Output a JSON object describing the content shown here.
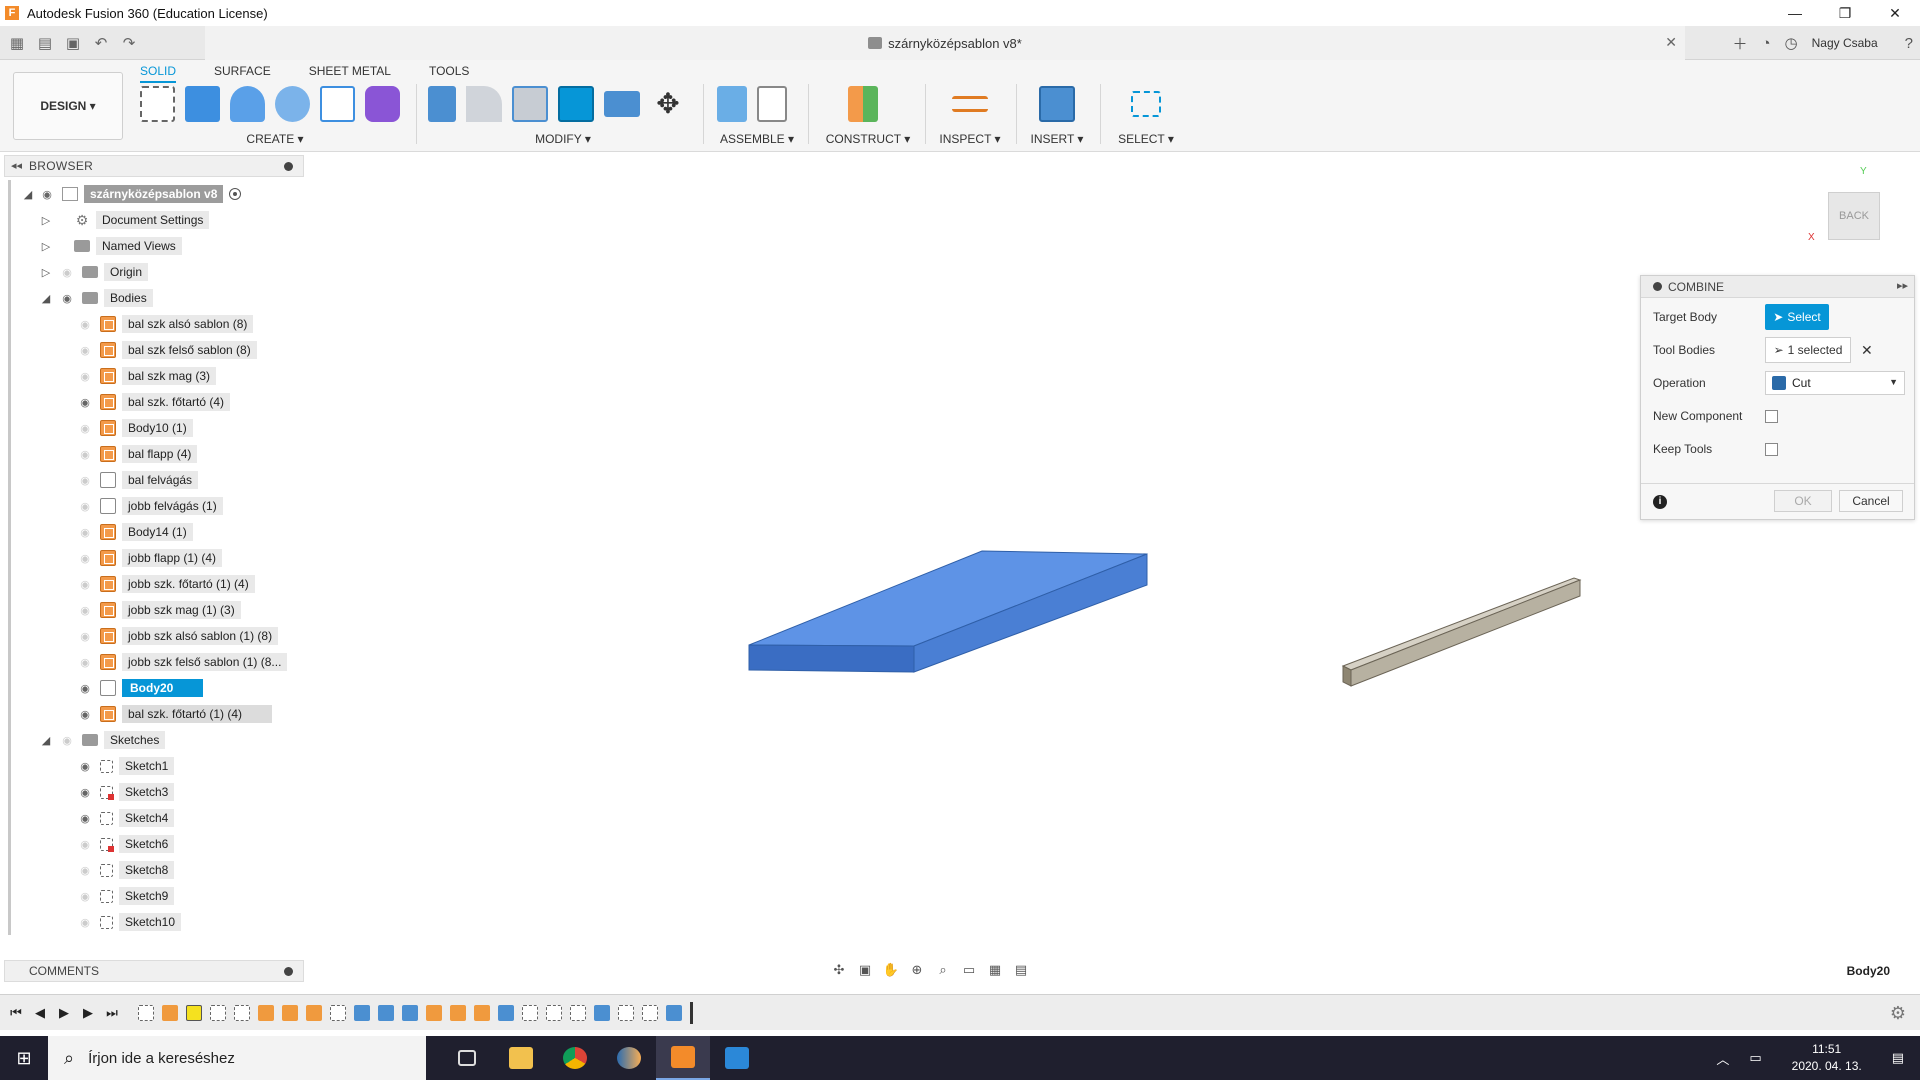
{
  "window": {
    "title": "Autodesk Fusion 360 (Education License)",
    "logo_letter": "F",
    "min": "—",
    "restore": "❐",
    "close": "✕"
  },
  "tabbar": {
    "doc_title": "szárnyközépsablon v8*",
    "user": "Nagy Csaba"
  },
  "ribbon": {
    "workspace": "DESIGN ▾",
    "tabs": [
      "SOLID",
      "SURFACE",
      "SHEET METAL",
      "TOOLS"
    ],
    "groups": {
      "create": "CREATE ▾",
      "modify": "MODIFY ▾",
      "assemble": "ASSEMBLE ▾",
      "construct": "CONSTRUCT ▾",
      "inspect": "INSPECT ▾",
      "insert": "INSERT ▾",
      "select": "SELECT ▾"
    }
  },
  "browser": {
    "title": "BROWSER",
    "root": "szárnyközépsablon v8",
    "document_settings": "Document Settings",
    "named_views": "Named Views",
    "origin": "Origin",
    "bodies_label": "Bodies",
    "bodies": [
      "bal szk alsó sablon (8)",
      "bal szk felső sablon (8)",
      "bal szk mag (3)",
      "bal szk. főtartó (4)",
      "Body10 (1)",
      "bal flapp (4)",
      "bal felvágás",
      "jobb  felvágás  (1)",
      "Body14 (1)",
      "jobb flapp (1) (4)",
      "jobb szk. főtartó (1) (4)",
      "jobb szk mag (1) (3)",
      "jobb szk alsó sablon (1) (8)",
      "jobb szk felső sablon (1) (8...",
      "Body20",
      "bal szk. főtartó (1) (4)"
    ],
    "sketches_label": "Sketches",
    "sketches": [
      "Sketch1",
      "Sketch3",
      "Sketch4",
      "Sketch6",
      "Sketch8",
      "Sketch9",
      "Sketch10"
    ]
  },
  "viewcube": {
    "face": "BACK",
    "x": "X",
    "y": "Y"
  },
  "combine": {
    "title": "COMBINE",
    "target_body_label": "Target Body",
    "target_body_value": "Select",
    "tool_bodies_label": "Tool Bodies",
    "tool_bodies_value": "1 selected",
    "operation_label": "Operation",
    "operation_value": "Cut",
    "new_component_label": "New Component",
    "keep_tools_label": "Keep Tools",
    "ok": "OK",
    "cancel": "Cancel"
  },
  "comments": {
    "title": "COMMENTS"
  },
  "status": {
    "selected_body": "Body20"
  },
  "taskbar": {
    "search_placeholder": "Írjon ide a kereséshez",
    "time": "11:51",
    "date": "2020. 04. 13."
  },
  "colors": {
    "accent": "#0696d7",
    "body_blue": "#4a7fd4",
    "body_orange": "#f39a4a"
  }
}
